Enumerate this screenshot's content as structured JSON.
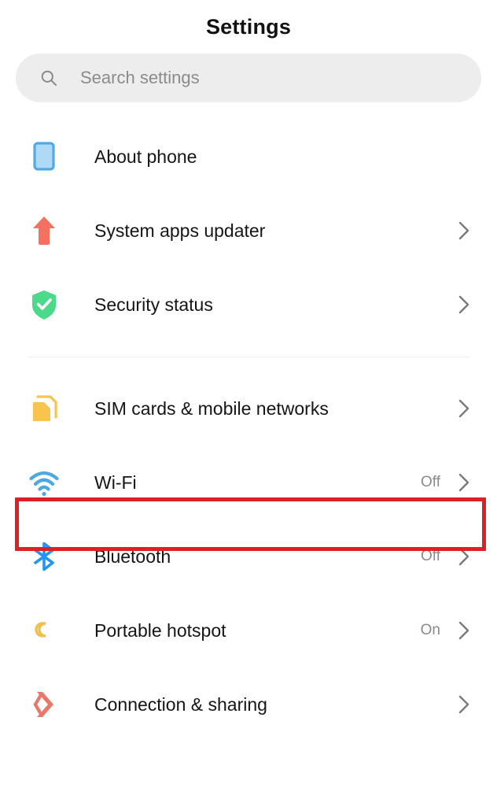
{
  "header": {
    "title": "Settings"
  },
  "search": {
    "icon": "search-icon",
    "placeholder": "Search settings",
    "value": ""
  },
  "colors": {
    "background": "#ffffff",
    "label_text": "#151515",
    "value_text": "#8a8a8a",
    "chevron": "#7a7a7a",
    "search_background": "#ededed",
    "search_placeholder": "#8b8b8b",
    "divider": "#f1f1f1",
    "highlight_border": "#dd2026",
    "icon_about_phone": "#4FABE8",
    "icon_about_phone_fill": "#AFD9F5",
    "icon_system_updater": "#F4705F",
    "icon_security": "#4BD98A",
    "icon_sim": "#F8C44E",
    "icon_wifi": "#4CA8E0",
    "icon_bluetooth": "#2196F3",
    "icon_hotspot": "#F0C04A",
    "icon_connection": "#E8796A"
  },
  "groups": [
    {
      "id": "device-group",
      "items": [
        {
          "id": "about-phone",
          "label": "About phone",
          "icon": "phone-outline-icon",
          "value": "",
          "chevron": false
        },
        {
          "id": "system-apps-updater",
          "label": "System apps updater",
          "icon": "up-arrow-icon",
          "value": "",
          "chevron": true
        },
        {
          "id": "security-status",
          "label": "Security status",
          "icon": "shield-check-icon",
          "value": "",
          "chevron": true
        }
      ]
    },
    {
      "id": "connectivity-group",
      "items": [
        {
          "id": "sim-cards-mobile-networks",
          "label": "SIM cards & mobile networks",
          "icon": "sim-card-icon",
          "value": "",
          "chevron": true
        },
        {
          "id": "wifi",
          "label": "Wi-Fi",
          "icon": "wifi-icon",
          "value": "Off",
          "chevron": true,
          "highlighted": true
        },
        {
          "id": "bluetooth",
          "label": "Bluetooth",
          "icon": "bluetooth-icon",
          "value": "Off",
          "chevron": true
        },
        {
          "id": "portable-hotspot",
          "label": "Portable hotspot",
          "icon": "hotspot-icon",
          "value": "On",
          "chevron": true
        },
        {
          "id": "connection-sharing",
          "label": "Connection & sharing",
          "icon": "connection-sharing-icon",
          "value": "",
          "chevron": true
        }
      ]
    }
  ]
}
